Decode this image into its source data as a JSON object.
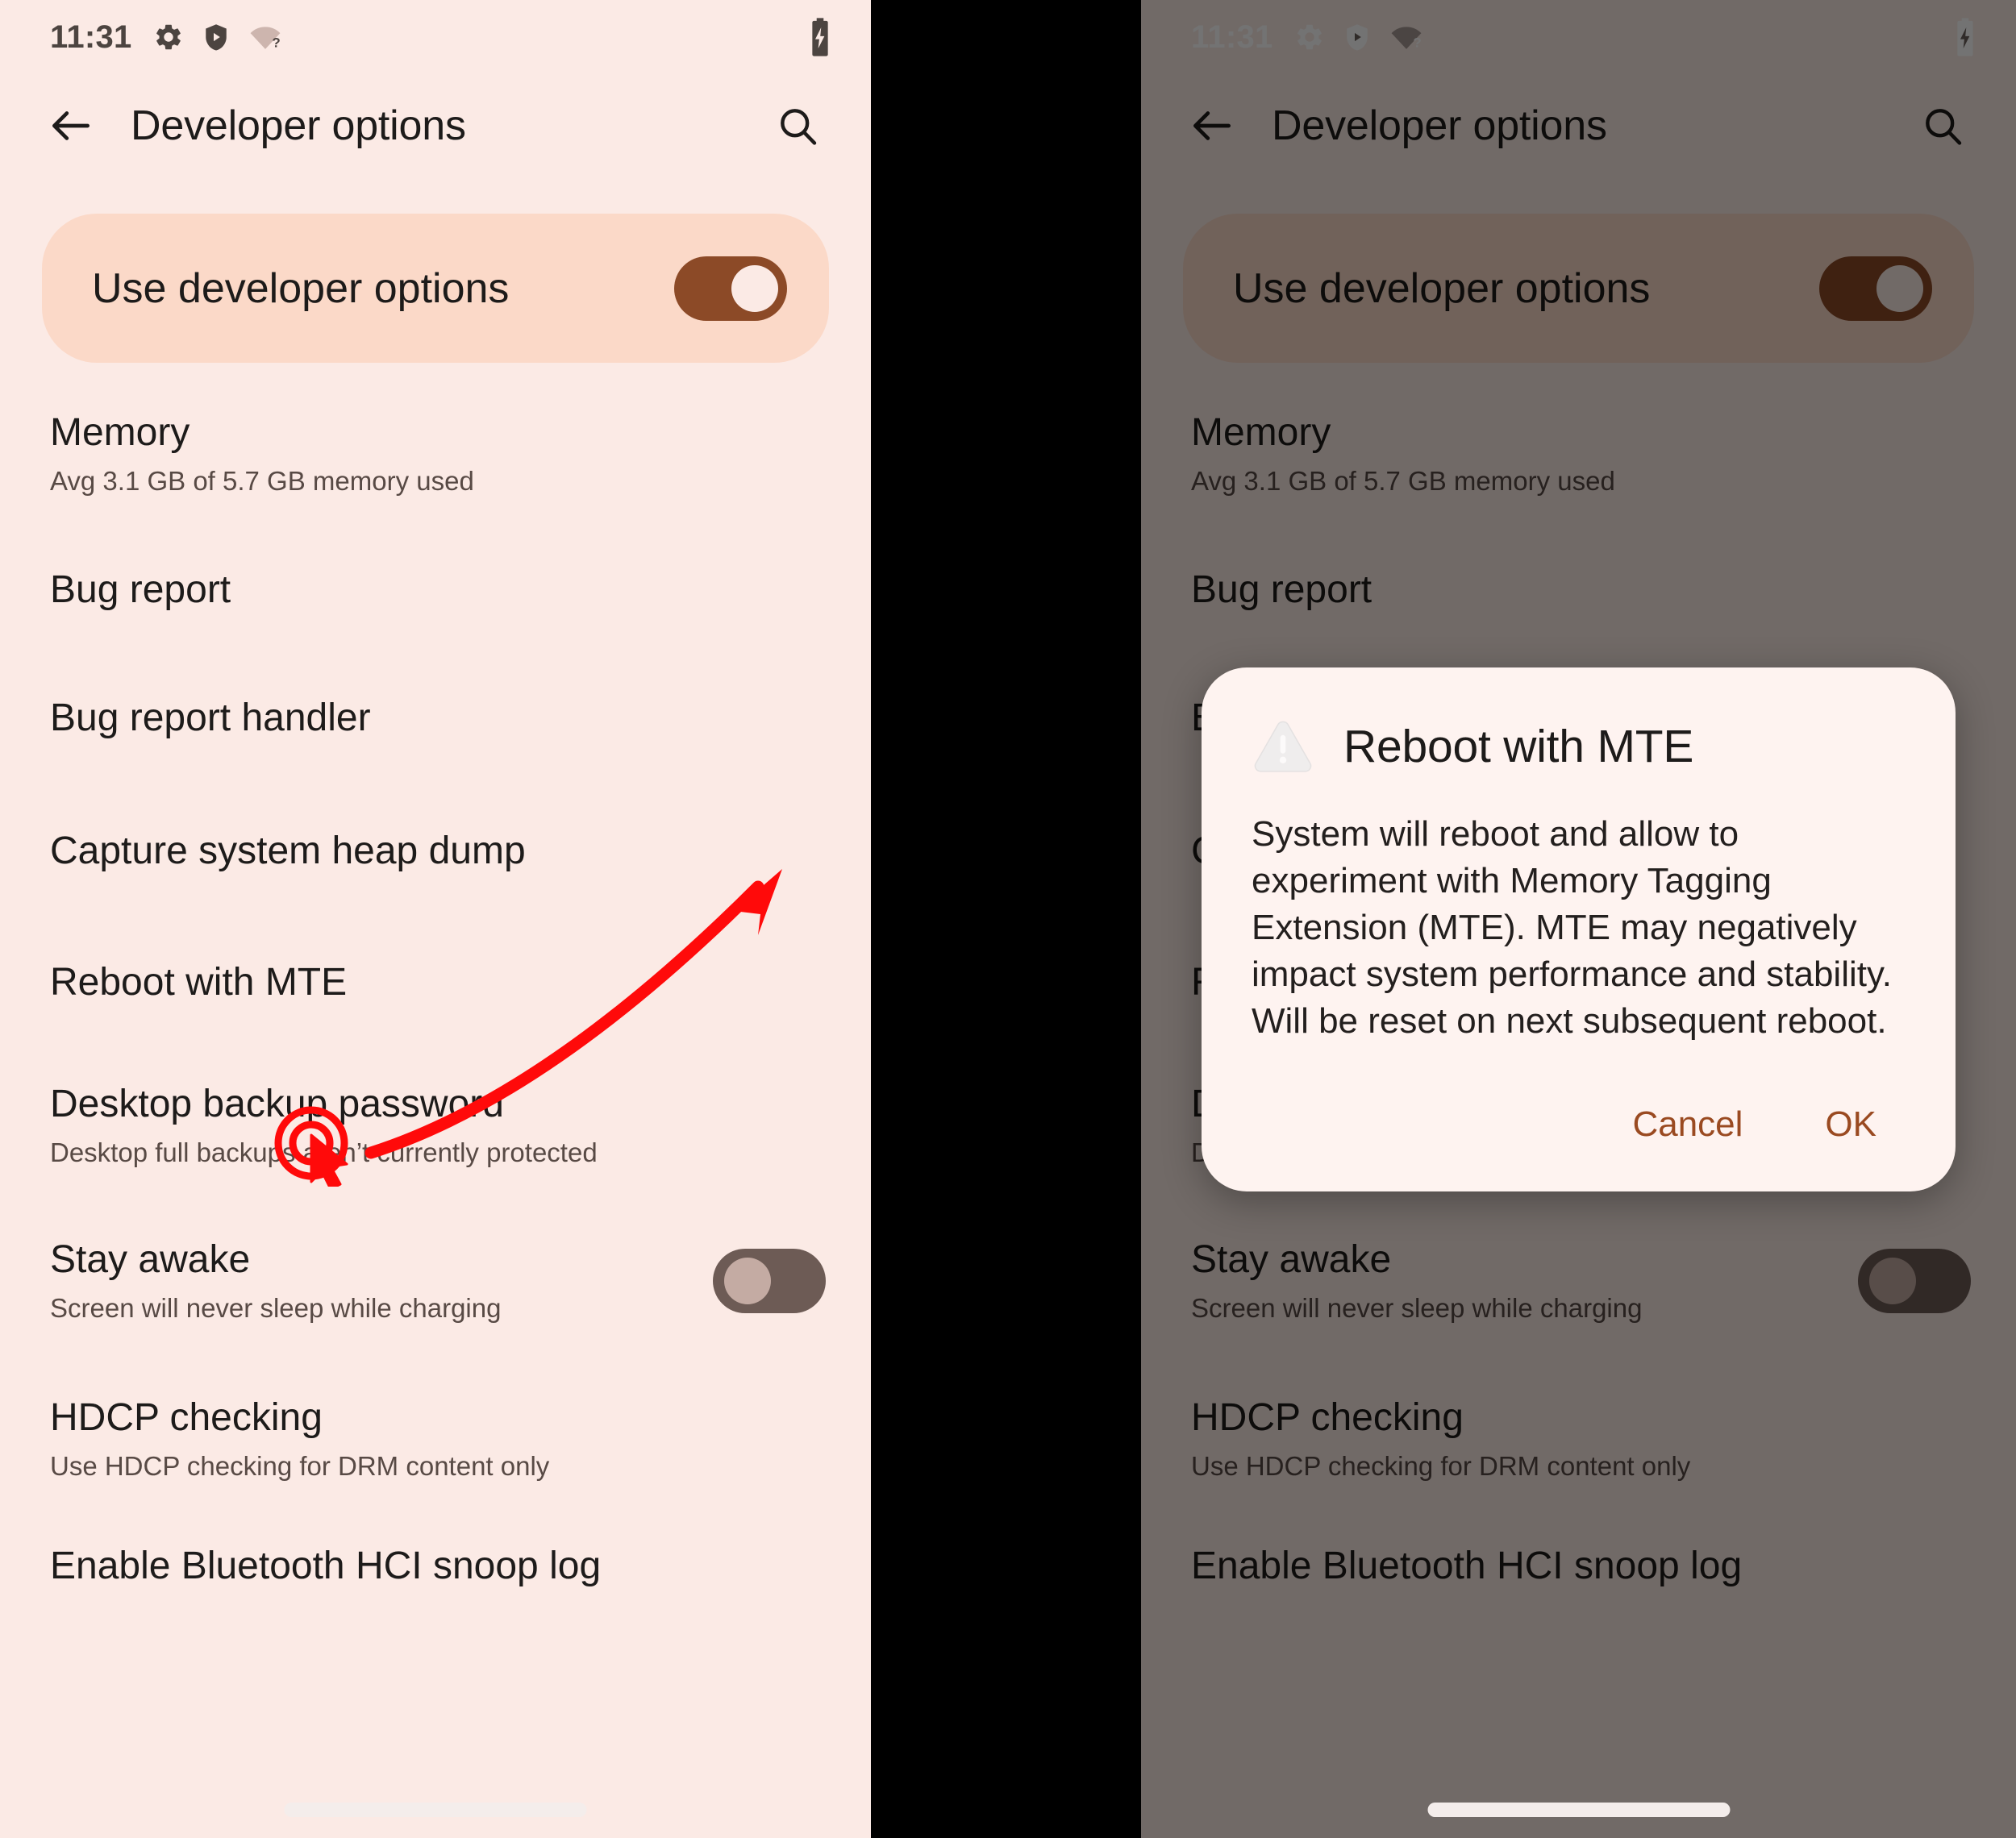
{
  "status_bar": {
    "time": "11:31",
    "icons": [
      "gear-icon",
      "shield-play-icon",
      "wifi-unknown-icon"
    ],
    "battery": "battery-charging-icon"
  },
  "app_bar": {
    "back_icon": "back-arrow-icon",
    "title": "Developer options",
    "search_icon": "search-icon"
  },
  "master_switch": {
    "label": "Use developer options",
    "state": "on"
  },
  "settings": [
    {
      "title": "Memory",
      "subtitle": "Avg 3.1 GB of 5.7 GB memory used",
      "toggle": null
    },
    {
      "title": "Bug report",
      "subtitle": "",
      "toggle": null
    },
    {
      "title": "Bug report handler",
      "subtitle": "",
      "toggle": null
    },
    {
      "title": "Capture system heap dump",
      "subtitle": "",
      "toggle": null
    },
    {
      "title": "Reboot with MTE",
      "subtitle": "",
      "toggle": null
    },
    {
      "title": "Desktop backup password",
      "subtitle": "Desktop full backups aren’t currently protected",
      "toggle": null
    },
    {
      "title": "Stay awake",
      "subtitle": "Screen will never sleep while charging",
      "toggle": "off"
    },
    {
      "title": "HDCP checking",
      "subtitle": "Use HDCP checking for DRM content only",
      "toggle": null
    },
    {
      "title": "Enable Bluetooth HCI snoop log",
      "subtitle": "",
      "toggle": null
    }
  ],
  "dialog": {
    "icon": "warning-triangle-icon",
    "title": "Reboot with MTE",
    "body": "System will reboot and allow to experiment with Memory Tagging Extension (MTE). MTE may negatively impact system performance and stability. Will be reset on next subsequent reboot.",
    "cancel_label": "Cancel",
    "ok_label": "OK"
  },
  "annotation": {
    "type": "click-target-with-arrow",
    "target_label": "Reboot with MTE",
    "color": "#FF0A0A"
  },
  "colors": {
    "surface": "#FBEAE5",
    "card": "#FBD9C8",
    "accent": "#8C4A27",
    "dialog_surface": "#FEF3F0",
    "dialog_action": "#9A4A21",
    "scrim": "rgba(0,0,0,0.55)",
    "status_text_left": "#4C4440",
    "status_text_right": "#FFFFFF",
    "gap": "#000000"
  }
}
